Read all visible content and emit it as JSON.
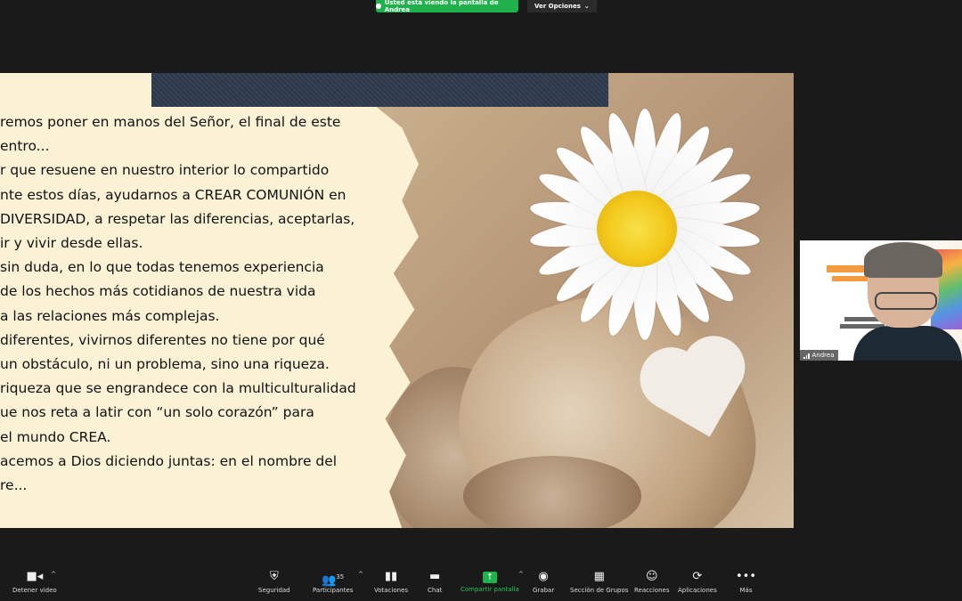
{
  "banner": {
    "text": "Usted está viendo la pantalla de Andrea",
    "view_options": "Ver Opciones"
  },
  "slide": {
    "lines": [
      "remos poner en manos del Señor, el final de este",
      "entro...",
      "r que resuene en nuestro interior lo compartido",
      "nte estos días, ayudarnos a CREAR COMUNIÓN en",
      "DIVERSIDAD, a respetar las diferencias, aceptarlas,",
      "ir y vivir desde ellas.",
      "sin duda, en lo que todas tenemos experiencia",
      "de los hechos más cotidianos de nuestra vida",
      "a las relaciones más complejas.",
      "diferentes, vivirnos diferentes no tiene por qué",
      "un obstáculo, ni un problema, sino una riqueza.",
      "riqueza que se engrandece con la multiculturalidad",
      "ue nos reta a latir con “un solo corazón” para",
      "el mundo CREA.",
      "acemos a Dios diciendo juntas: en el nombre del",
      "re..."
    ]
  },
  "participant": {
    "name": "Andrea"
  },
  "toolbar": {
    "detener_video": "Detener video",
    "seguridad": "Seguridad",
    "participantes": "Participantes",
    "participantes_count": "35",
    "votaciones": "Votaciones",
    "chat": "Chat",
    "compartir": "Compartir pantalla",
    "grabar": "Grabar",
    "grupos": "Sección de Grupos",
    "reacciones": "Reacciones",
    "aplicaciones": "Aplicaciones",
    "mas": "Más"
  }
}
